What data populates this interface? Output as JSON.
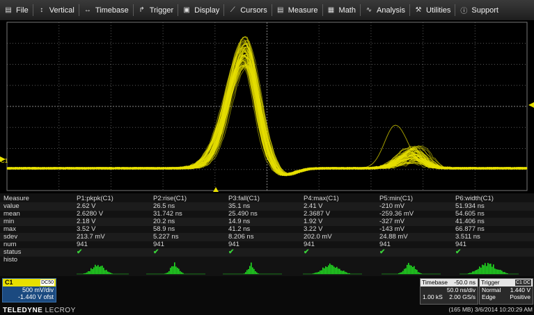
{
  "menu": {
    "items": [
      {
        "label": "File",
        "icon": "file-icon"
      },
      {
        "label": "Vertical",
        "icon": "vertical-icon"
      },
      {
        "label": "Timebase",
        "icon": "timebase-icon"
      },
      {
        "label": "Trigger",
        "icon": "trigger-icon"
      },
      {
        "label": "Display",
        "icon": "display-icon"
      },
      {
        "label": "Cursors",
        "icon": "cursors-icon"
      },
      {
        "label": "Measure",
        "icon": "measure-icon"
      },
      {
        "label": "Math",
        "icon": "math-icon"
      },
      {
        "label": "Analysis",
        "icon": "analysis-icon"
      },
      {
        "label": "Utilities",
        "icon": "utilities-icon"
      },
      {
        "label": "Support",
        "icon": "support-icon"
      }
    ]
  },
  "trace": {
    "label": "C1",
    "color": "#e8e000"
  },
  "measure": {
    "row_labels": [
      "Measure",
      "value",
      "mean",
      "min",
      "max",
      "sdev",
      "num",
      "status",
      "histo"
    ],
    "columns": [
      {
        "header": "P1:pkpk(C1)",
        "value": "2.62 V",
        "mean": "2.6280 V",
        "min": "2.18 V",
        "max": "3.52 V",
        "sdev": "213.7 mV",
        "num": "941"
      },
      {
        "header": "P2:rise(C1)",
        "value": "26.5 ns",
        "mean": "31.742 ns",
        "min": "20.2 ns",
        "max": "58.9 ns",
        "sdev": "5.227 ns",
        "num": "941"
      },
      {
        "header": "P3:fall(C1)",
        "value": "35.1 ns",
        "mean": "25.490 ns",
        "min": "14.9 ns",
        "max": "41.2 ns",
        "sdev": "8.206 ns",
        "num": "941"
      },
      {
        "header": "P4:max(C1)",
        "value": "2.41 V",
        "mean": "2.3687 V",
        "min": "1.92 V",
        "max": "3.22 V",
        "sdev": "202.0 mV",
        "num": "941"
      },
      {
        "header": "P5:min(C1)",
        "value": "-210 mV",
        "mean": "-259.36 mV",
        "min": "-327 mV",
        "max": "-143 mV",
        "sdev": "24.88 mV",
        "num": "941"
      },
      {
        "header": "P6:width(C1)",
        "value": "51.934 ns",
        "mean": "54.605 ns",
        "min": "41.406 ns",
        "max": "66.877 ns",
        "sdev": "3.511 ns",
        "num": "941"
      }
    ],
    "status_icon": "check-icon",
    "status_color": "#3ad03a"
  },
  "channel": {
    "name": "C1",
    "coupling": "DC50",
    "scale": "500 mV/div",
    "offset": "-1.440 V ofst"
  },
  "timebase": {
    "title": "Timebase",
    "delay": "-50.0 ns",
    "scale": "50.0 ns/div",
    "samples": "1.00 kS",
    "rate": "2.00 GS/s"
  },
  "trigger": {
    "title": "Trigger",
    "source": "C1 DC",
    "mode": "Normal",
    "level": "1.440 V",
    "type": "Edge",
    "slope": "Positive"
  },
  "brand": {
    "bold": "TELEDYNE",
    "light": "LECROY"
  },
  "status": {
    "memory": "(165 MB)",
    "datetime": "3/6/2014 10:20:29 AM"
  },
  "colors": {
    "trace": "#e8e000",
    "histogram": "#22dd22",
    "channel_panel": "#1b4a80"
  }
}
